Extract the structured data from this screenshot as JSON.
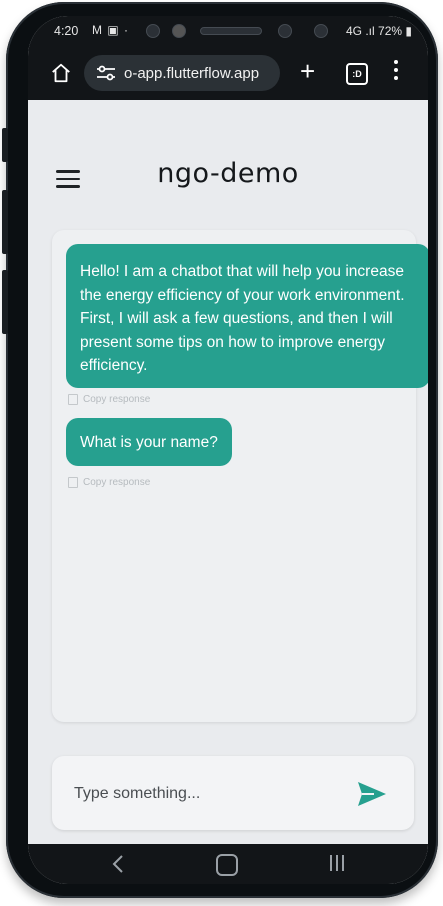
{
  "status_bar": {
    "time": "4:20",
    "left_icons": "M ▣ ·",
    "signal": "4G",
    "battery": "72%"
  },
  "browser": {
    "url": "o-app.flutterflow.app",
    "tabs_label": ":D",
    "icons": [
      "home-icon",
      "site-settings-icon",
      "new-tab-icon",
      "tab-switcher-icon",
      "menu-icon"
    ]
  },
  "app": {
    "title": "ngo-demo"
  },
  "chat": {
    "messages": [
      {
        "text": "Hello! I am a chatbot that will help you increase the energy efficiency of your work environment. First, I will ask a few questions, and then I will present some tips on how to improve energy efficiency.",
        "copy_label": "Copy response"
      },
      {
        "text": "What is your name?",
        "copy_label": "Copy response"
      }
    ]
  },
  "input": {
    "placeholder": "Type something...",
    "value": ""
  },
  "colors": {
    "accent": "#26a08f",
    "background": "#e9ebee",
    "system_bar": "#121518"
  }
}
